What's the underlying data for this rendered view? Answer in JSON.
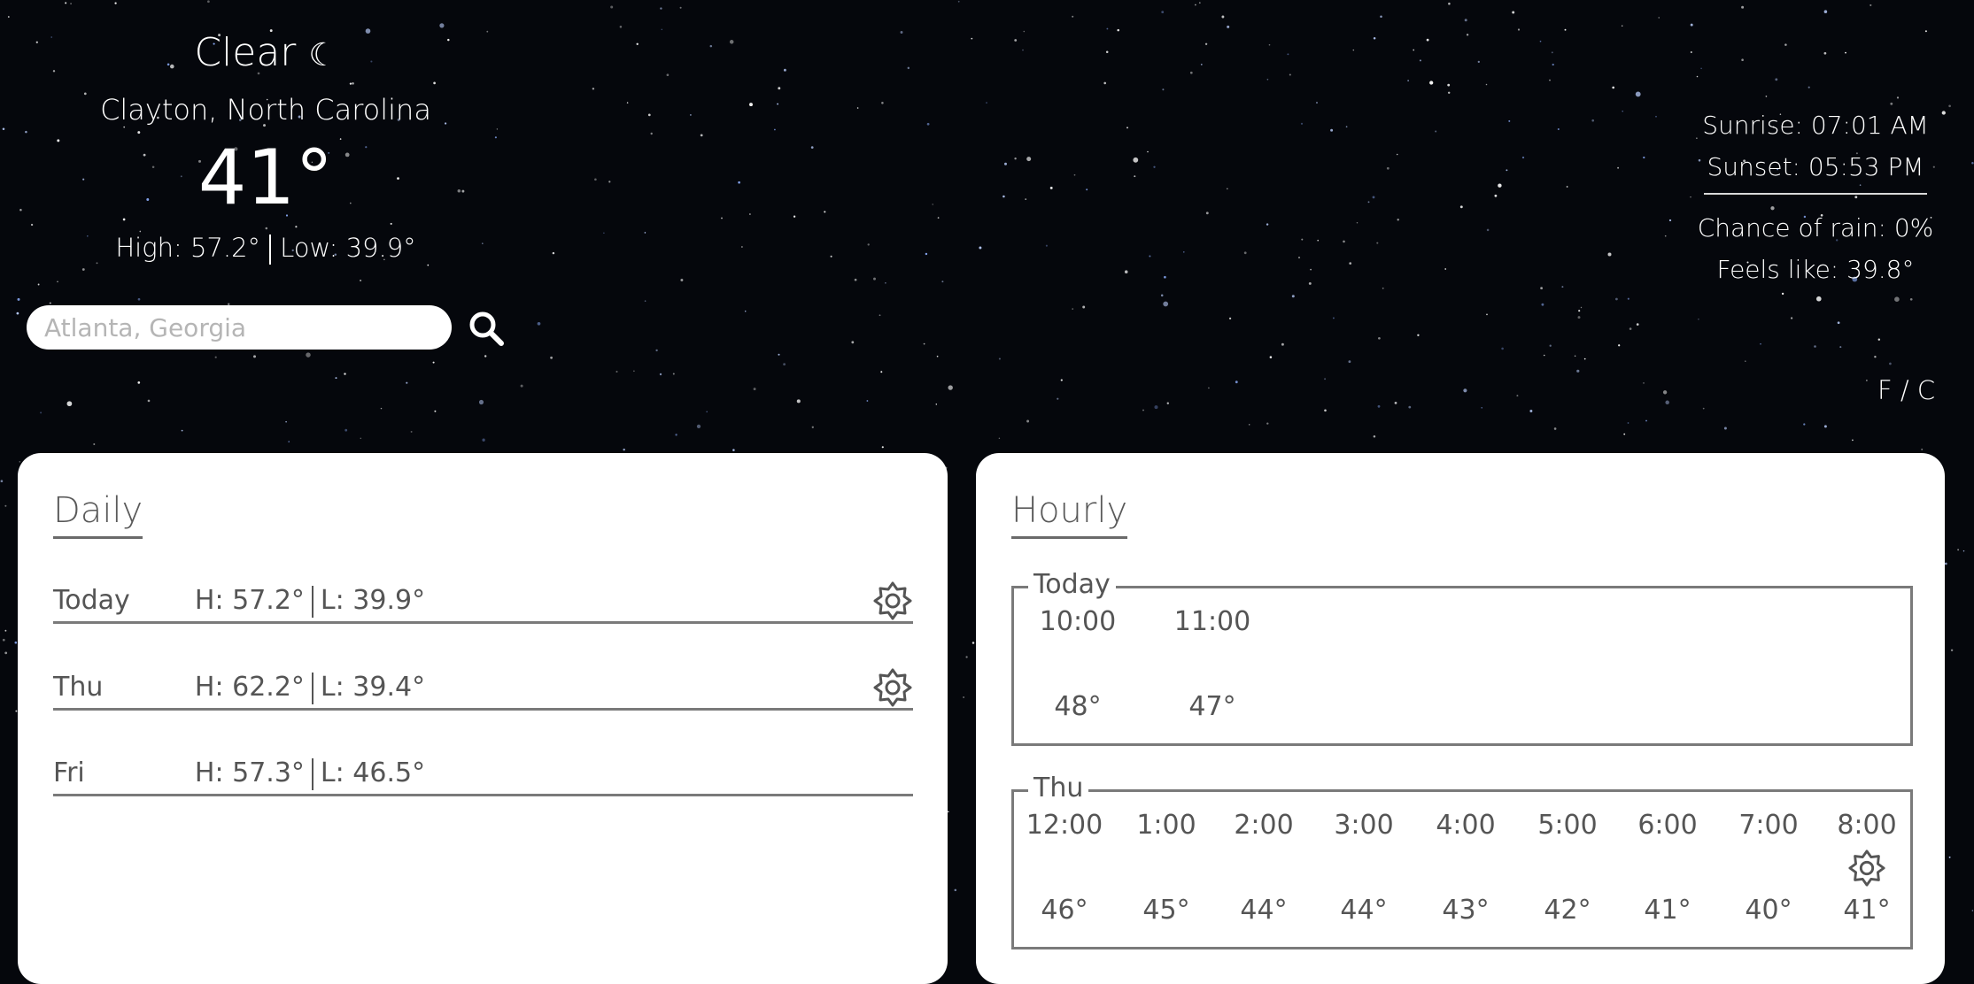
{
  "current": {
    "condition": "Clear",
    "condition_icon": "☾",
    "location": "Clayton, North Carolina",
    "temperature": "41°",
    "high": "High: 57.2°",
    "low": "Low: 39.9°"
  },
  "search": {
    "placeholder": "Atlanta, Georgia"
  },
  "info": {
    "sunrise": "Sunrise: 07:01 AM",
    "sunset": "Sunset: 05:53 PM",
    "rain": "Chance of rain: 0%",
    "feels_like": "Feels like: 39.8°"
  },
  "unit_toggle": "F / C",
  "daily": {
    "title": "Daily",
    "days": [
      {
        "name": "Today",
        "high": "H: 57.2°",
        "low": "L: 39.9°",
        "icon": "sun-icon"
      },
      {
        "name": "Thu",
        "high": "H: 62.2°",
        "low": "L: 39.4°",
        "icon": "sun-icon"
      },
      {
        "name": "Fri",
        "high": "H: 57.3°",
        "low": "L: 46.5°"
      }
    ]
  },
  "hourly": {
    "title": "Hourly",
    "groups": [
      {
        "label": "Today",
        "hours": [
          {
            "time": "10:00",
            "temp": "48°"
          },
          {
            "time": "11:00",
            "temp": "47°"
          }
        ]
      },
      {
        "label": "Thu",
        "hours": [
          {
            "time": "12:00",
            "temp": "46°"
          },
          {
            "time": "1:00",
            "temp": "45°"
          },
          {
            "time": "2:00",
            "temp": "44°"
          },
          {
            "time": "3:00",
            "temp": "44°"
          },
          {
            "time": "4:00",
            "temp": "43°"
          },
          {
            "time": "5:00",
            "temp": "42°"
          },
          {
            "time": "6:00",
            "temp": "41°"
          },
          {
            "time": "7:00",
            "temp": "40°"
          },
          {
            "time": "8:00",
            "temp": "41°",
            "icon": "sun-icon"
          }
        ]
      }
    ]
  },
  "colors": {
    "background": "#05070c",
    "panel": "#ffffff",
    "panel_text": "#555555"
  }
}
